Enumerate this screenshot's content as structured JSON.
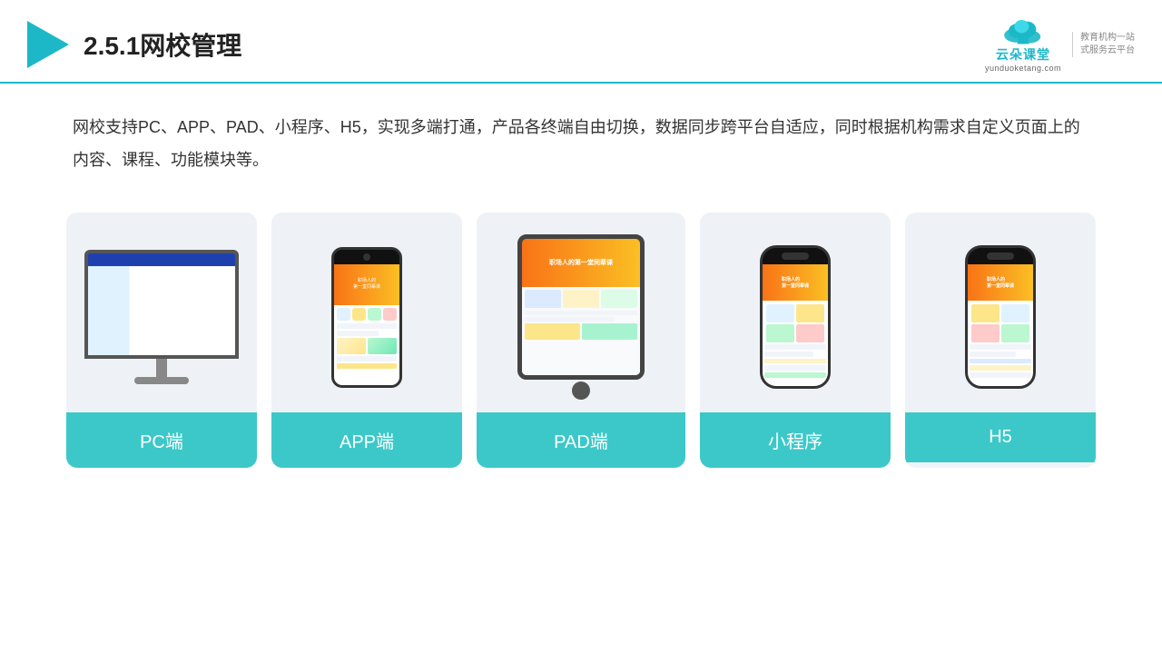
{
  "header": {
    "title": "2.5.1网校管理",
    "logo": {
      "main": "云朵课堂",
      "sub": "yunduoketang.com",
      "slogan_line1": "教育机构一站",
      "slogan_line2": "式服务云平台"
    }
  },
  "description": {
    "text": "网校支持PC、APP、PAD、小程序、H5，实现多端打通，产品各终端自由切换，数据同步跨平台自适应，同时根据机构需求自定义页面上的内容、课程、功能模块等。"
  },
  "cards": [
    {
      "id": "pc",
      "label": "PC端"
    },
    {
      "id": "app",
      "label": "APP端"
    },
    {
      "id": "pad",
      "label": "PAD端"
    },
    {
      "id": "miniprogram",
      "label": "小程序"
    },
    {
      "id": "h5",
      "label": "H5"
    }
  ],
  "colors": {
    "accent": "#3cc8c8",
    "header_line": "#1db8c8",
    "text_primary": "#333",
    "card_bg": "#eef2f7"
  }
}
